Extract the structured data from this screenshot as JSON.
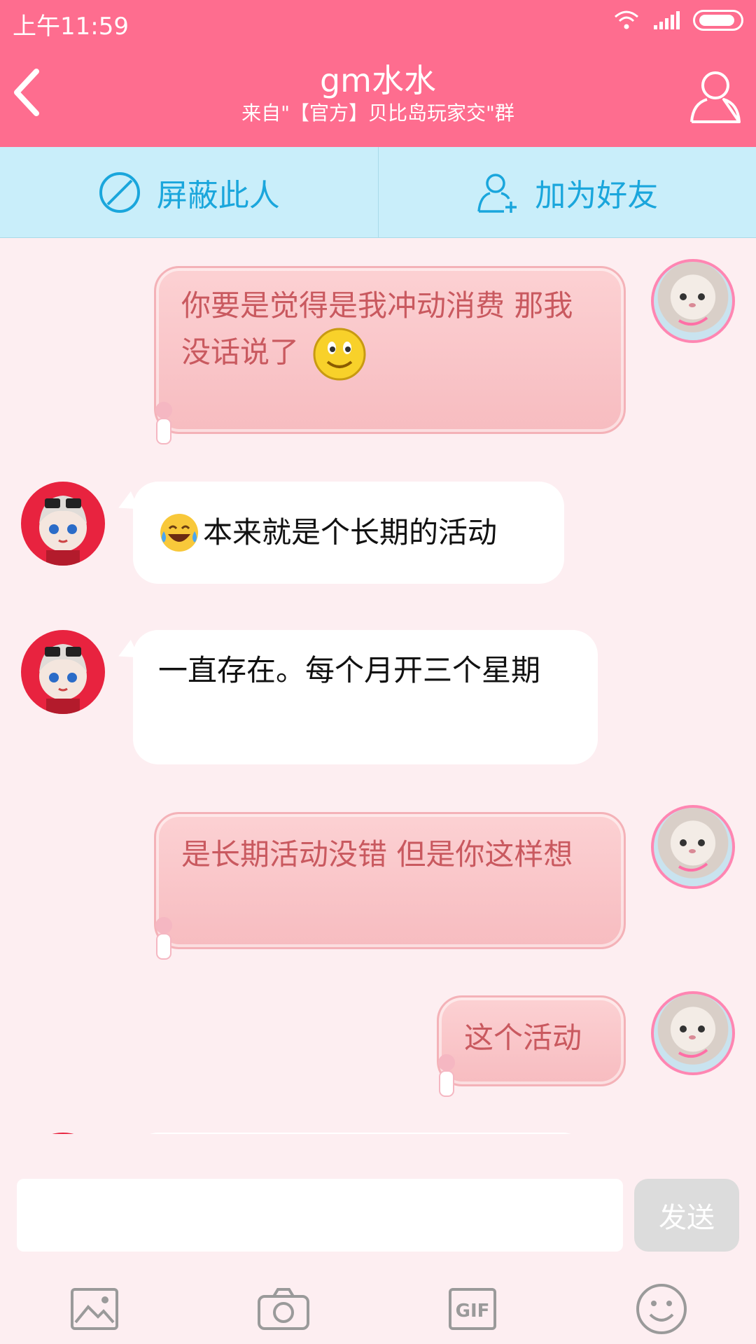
{
  "status": {
    "time": "上午11:59"
  },
  "header": {
    "title": "gm水水",
    "subtitle": "来自\"【官方】贝比岛玩家交\"群"
  },
  "actions": {
    "block_label": "屏蔽此人",
    "add_friend_label": "加为好友"
  },
  "messages": [
    {
      "side": "right",
      "text": "你要是觉得是我冲动消费 那我没话说了",
      "emoji": "smile"
    },
    {
      "side": "left",
      "emoji": "laugh-tears",
      "text": "本来就是个长期的活动"
    },
    {
      "side": "left",
      "text": "一直存在。每个月开三个星期"
    },
    {
      "side": "right",
      "text": "是长期活动没错 但是你这样想"
    },
    {
      "side": "right",
      "text": "这个活动"
    }
  ],
  "composer": {
    "input_value": "",
    "input_placeholder": "",
    "send_label": "发送"
  },
  "toolbar": {
    "icons": [
      "image-icon",
      "camera-icon",
      "gif-icon",
      "emoji-icon"
    ],
    "gif_label": "GIF"
  },
  "colors": {
    "header": "#fe6d8f",
    "action_bar": "#c9eefa",
    "accent_blue": "#1aa6dc",
    "chat_bg": "#fdeef1",
    "pink_bubble": "#fcd1d3",
    "pink_text": "#c9595f"
  }
}
